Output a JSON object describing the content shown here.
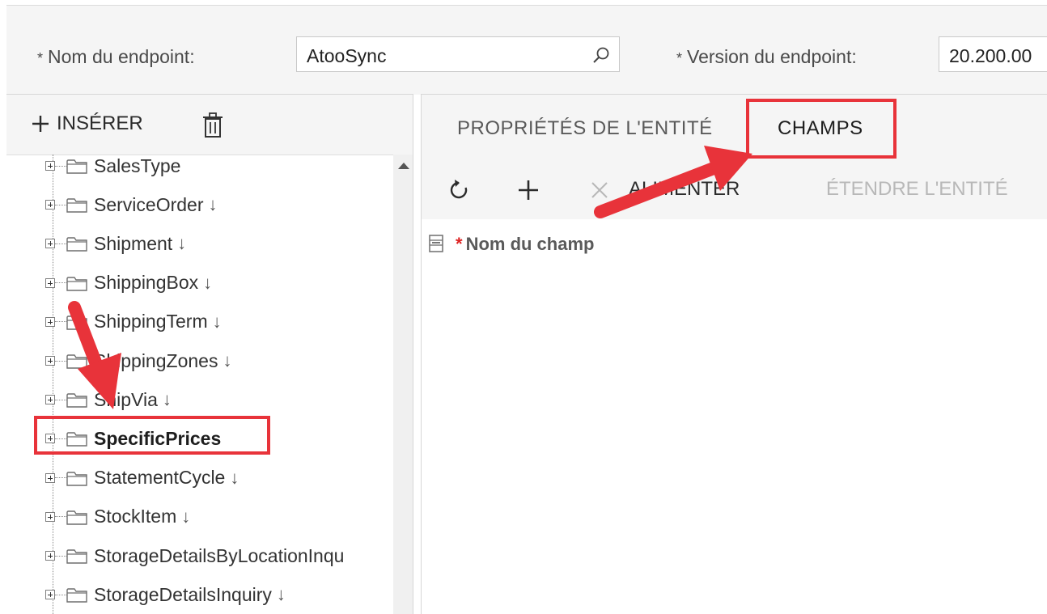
{
  "form": {
    "endpoint_name_label": "Nom du endpoint:",
    "endpoint_name_value": "AtooSync",
    "endpoint_version_label": "Version du endpoint:",
    "endpoint_version_value": "20.200.00",
    "required_marker": "*"
  },
  "left_toolbar": {
    "insert_label": "INSÉRER"
  },
  "tree": {
    "down_marker": "↓",
    "items": [
      {
        "label": "SalesType",
        "bold": false,
        "marker": false
      },
      {
        "label": "ServiceOrder",
        "bold": false,
        "marker": true
      },
      {
        "label": "Shipment",
        "bold": false,
        "marker": true
      },
      {
        "label": "ShippingBox",
        "bold": false,
        "marker": true
      },
      {
        "label": "ShippingTerm",
        "bold": false,
        "marker": true
      },
      {
        "label": "ShippingZones",
        "bold": false,
        "marker": true
      },
      {
        "label": "ShipVia",
        "bold": false,
        "marker": true
      },
      {
        "label": "SpecificPrices",
        "bold": true,
        "marker": false
      },
      {
        "label": "StatementCycle",
        "bold": false,
        "marker": true
      },
      {
        "label": "StockItem",
        "bold": false,
        "marker": true
      },
      {
        "label": "StorageDetailsByLocationInqu",
        "bold": false,
        "marker": false
      },
      {
        "label": "StorageDetailsInquiry",
        "bold": false,
        "marker": true
      }
    ]
  },
  "tabs": [
    {
      "label": "PROPRIÉTÉS DE L'ENTITÉ",
      "active": false
    },
    {
      "label": "CHAMPS",
      "active": true
    }
  ],
  "fields_toolbar": {
    "populate_label": "ALIMENTER",
    "extend_label": "ÉTENDRE L'ENTITÉ"
  },
  "grid": {
    "column_header": "Nom du champ",
    "required_marker": "*"
  },
  "colors": {
    "annotation": "#e8333a",
    "panel_bg": "#f5f5f5",
    "disabled_text": "#b8b8b8"
  }
}
